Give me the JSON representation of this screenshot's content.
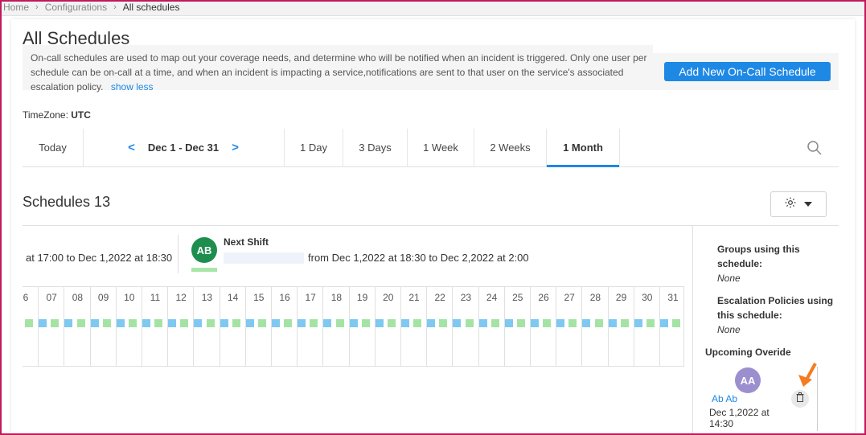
{
  "breadcrumb": {
    "home": "Home",
    "configurations": "Configurations",
    "current": "All schedules"
  },
  "page": {
    "title": "All Schedules",
    "description": "On-call schedules are used to map out your coverage needs, and determine who will be notified when an incident is triggered. Only one user per schedule can be on-call at a time, and when an incident is impacting a service,notifications are sent to that user on the service's associated escalation policy.",
    "show_less": "show less",
    "add_button": "Add New On-Call Schedule"
  },
  "timezone": {
    "label": "TimeZone:",
    "value": "UTC"
  },
  "toolbar": {
    "today": "Today",
    "range": "Dec 1 - Dec 31",
    "views": [
      "1 Day",
      "3 Days",
      "1 Week",
      "2 Weeks",
      "1 Month"
    ],
    "active_view": "1 Month"
  },
  "schedules": {
    "title": "Schedules 13"
  },
  "current_shift": {
    "time": "at 17:00 to Dec 1,2022 at 18:30"
  },
  "next_shift": {
    "label": "Next Shift",
    "initials": "AB",
    "time": "from Dec 1,2022 at 18:30 to Dec 2,2022 at 2:00"
  },
  "timeline": {
    "days": [
      "6",
      "07",
      "08",
      "09",
      "10",
      "11",
      "12",
      "13",
      "14",
      "15",
      "16",
      "17",
      "18",
      "19",
      "20",
      "21",
      "22",
      "23",
      "24",
      "25",
      "26",
      "27",
      "28",
      "29",
      "30",
      "31"
    ]
  },
  "sidebar": {
    "groups_label": "Groups using this schedule:",
    "groups_value": "None",
    "escalation_label": "Escalation Policies using this schedule:",
    "escalation_value": "None",
    "upcoming_title": "Upcoming Overide",
    "override": {
      "initials": "AA",
      "name": "Ab Ab",
      "time": "Dec 1,2022 at 14:30"
    }
  },
  "colors": {
    "accent": "#1e88e5",
    "avatar_ab": "#1e8e4e",
    "avatar_aa": "#9b8fcf",
    "shift_blue": "#7ec8f2",
    "shift_green": "#a5e3a5",
    "annotation_arrow": "#f57c20"
  }
}
